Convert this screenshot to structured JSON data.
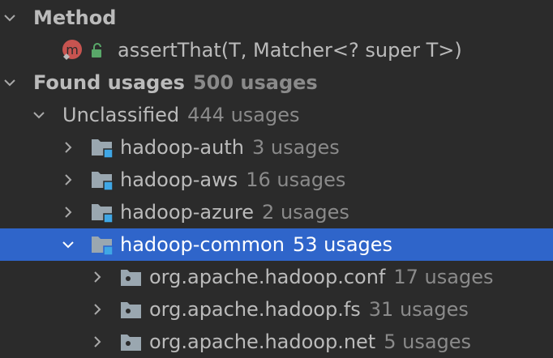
{
  "rows": [
    {
      "label": "Method",
      "count": ""
    },
    {
      "label": "assertThat(T, Matcher<? super T>)",
      "count": "",
      "icon_letter": "m"
    },
    {
      "label": "Found usages",
      "count": "500 usages"
    },
    {
      "label": "Unclassified",
      "count": "444 usages"
    },
    {
      "label": "hadoop-auth",
      "count": "3 usages"
    },
    {
      "label": "hadoop-aws",
      "count": "16 usages"
    },
    {
      "label": "hadoop-azure",
      "count": "2 usages"
    },
    {
      "label": "hadoop-common",
      "count": "53 usages"
    },
    {
      "label": "org.apache.hadoop.conf",
      "count": "17 usages"
    },
    {
      "label": "org.apache.hadoop.fs",
      "count": "31 usages"
    },
    {
      "label": "org.apache.hadoop.net",
      "count": "5 usages"
    }
  ],
  "icons": {
    "chevron_expanded": "chevron-down-icon",
    "chevron_collapsed": "chevron-right-icon",
    "module": "module-folder-icon",
    "package": "package-icon",
    "method": "method-icon",
    "visibility": "public-lock-icon"
  },
  "colors": {
    "background": "#2b2b2b",
    "selection": "#2f65ca",
    "text": "#bbbbbb",
    "count": "#8a8a8a",
    "module_badge": "#3fa7e6",
    "method_badge": "#c75450",
    "lock": "#59a869"
  }
}
